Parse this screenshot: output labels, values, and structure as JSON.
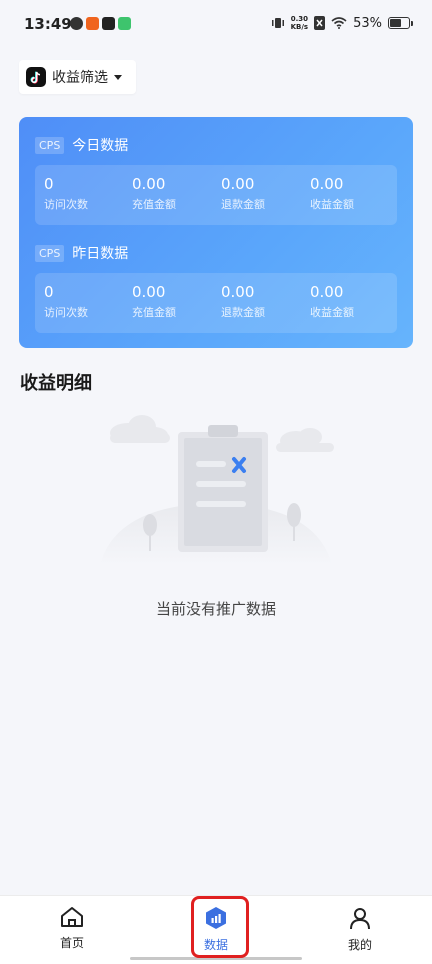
{
  "status_bar": {
    "time": "13:49",
    "net_speed_value": "0.30",
    "net_speed_unit": "KB/s",
    "battery": "53%"
  },
  "filter": {
    "label": "收益筛选"
  },
  "today": {
    "tag": "CPS",
    "title": "今日数据",
    "stats": [
      {
        "value": "0",
        "label": "访问次数"
      },
      {
        "value": "0.00",
        "label": "充值金额"
      },
      {
        "value": "0.00",
        "label": "退款金额"
      },
      {
        "value": "0.00",
        "label": "收益金额"
      }
    ]
  },
  "yesterday": {
    "tag": "CPS",
    "title": "昨日数据",
    "stats": [
      {
        "value": "0",
        "label": "访问次数"
      },
      {
        "value": "0.00",
        "label": "充值金额"
      },
      {
        "value": "0.00",
        "label": "退款金额"
      },
      {
        "value": "0.00",
        "label": "收益金额"
      }
    ]
  },
  "detail": {
    "title": "收益明细",
    "empty_text": "当前没有推广数据"
  },
  "nav": {
    "items": [
      {
        "label": "首页",
        "icon": "home-icon"
      },
      {
        "label": "数据",
        "icon": "data-chart-icon",
        "active": true
      },
      {
        "label": "我的",
        "icon": "user-icon"
      }
    ]
  },
  "colors": {
    "accent": "#3b6fe0",
    "card_gradient_start": "#4f8ef7",
    "card_gradient_end": "#66b4fc",
    "highlight": "#e02020"
  }
}
